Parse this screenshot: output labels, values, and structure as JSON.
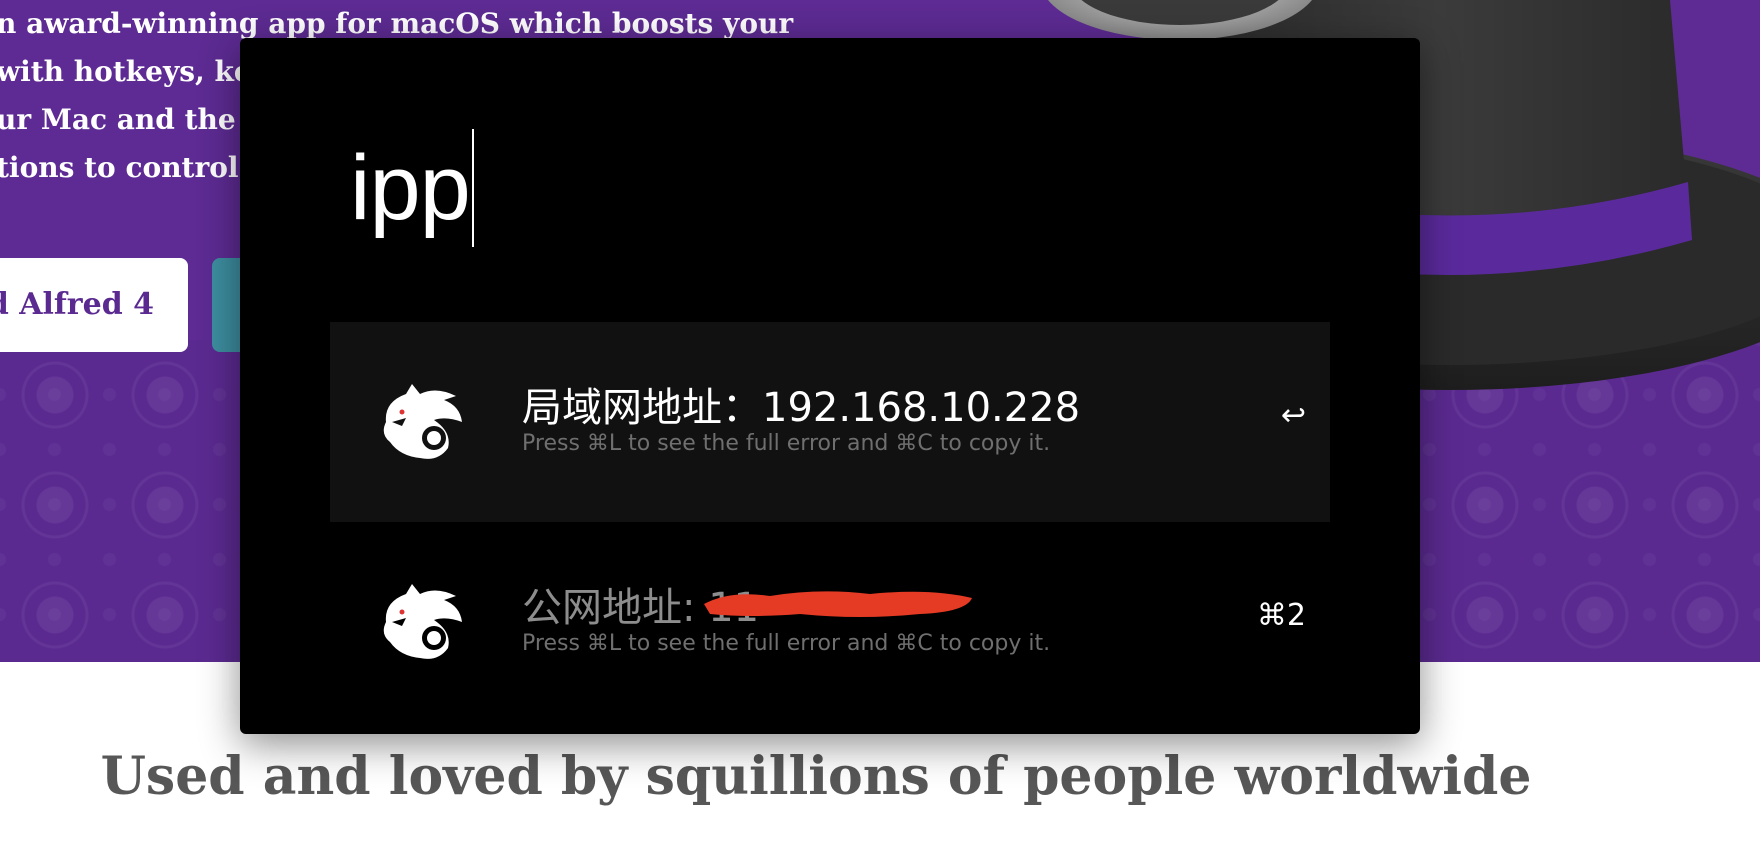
{
  "background": {
    "hero_lines": [
      "n award-winning app for macOS which boosts your",
      "with hotkeys, ke",
      "ur Mac and the w",
      "tions to control y"
    ],
    "download_button": "d Alfred 4",
    "tagline": "Used and loved by squillions of people worldwide",
    "hero_color": "#5b2a91"
  },
  "launcher": {
    "query": "ipp",
    "results": [
      {
        "title": "局域网地址：192.168.10.228",
        "subtitle": "Press ⌘L to see the full error and ⌘C to copy it.",
        "shortcut": "↩",
        "icon": "lion-icon",
        "selected": true
      },
      {
        "title": "公网地址: 11",
        "subtitle": "Press ⌘L to see the full error and ⌘C to copy it.",
        "shortcut": "⌘2",
        "icon": "lion-icon",
        "selected": false
      }
    ],
    "colors": {
      "background": "#000000",
      "selected_row": "#111111",
      "redaction": "#e53a24"
    }
  }
}
